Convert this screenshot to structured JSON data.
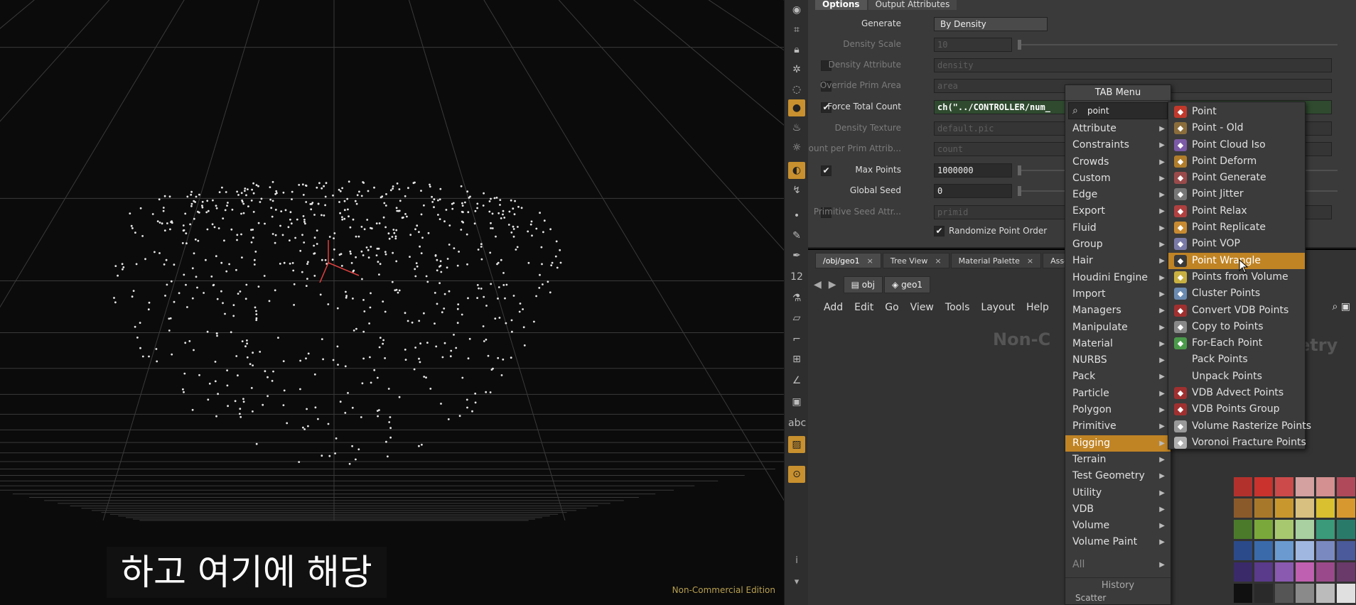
{
  "viewport": {
    "subtitle": "하고 여기에 해당",
    "edition_label": "Non-Commercial Edition"
  },
  "toolstrip": {
    "info_icon_label": "i",
    "abc_label": "abc",
    "num_label": "12"
  },
  "params": {
    "tabs": [
      "Options",
      "Output Attributes"
    ],
    "rows": [
      {
        "label": "Generate",
        "value": "By Density",
        "type": "select"
      },
      {
        "label": "Density Scale",
        "value": "10",
        "type": "field-dim",
        "dim": true
      },
      {
        "label": "Density Attribute",
        "value": "density",
        "type": "field-wide-dim",
        "dim": true,
        "check": ""
      },
      {
        "label": "Override Prim Area",
        "value": "area",
        "type": "field-wide-dim",
        "dim": true,
        "check": ""
      },
      {
        "label": "Force Total Count",
        "value": "ch(\"../CONTROLLER/num_",
        "type": "expr",
        "check": "✔"
      },
      {
        "label": "Density Texture",
        "value": "default.pic",
        "type": "field-wide-dim",
        "dim": true
      },
      {
        "label": "Count per Prim Attrib...",
        "value": "count",
        "type": "field-wide-dim",
        "dim": true
      },
      {
        "label": "Max Points",
        "value": "1000000",
        "type": "field",
        "check": "✔"
      },
      {
        "label": "Global Seed",
        "value": "0",
        "type": "field"
      },
      {
        "label": "Primitive Seed Attr...",
        "value": "primid",
        "type": "field-wide-dim",
        "dim": true,
        "check": ""
      }
    ],
    "randomize_label": "Randomize Point Order"
  },
  "network": {
    "tabs": [
      "/obj/geo1",
      "Tree View",
      "Material Palette",
      "Asset Bro"
    ],
    "path": [
      "obj",
      "geo1"
    ],
    "menu": [
      "Add",
      "Edit",
      "Go",
      "View",
      "Tools",
      "Layout",
      "Help"
    ],
    "bg_text_left": "Non-C",
    "bg_text_right": "etry"
  },
  "tab_menu": {
    "title": "TAB Menu",
    "search_value": "point",
    "categories": [
      "Attribute",
      "Constraints",
      "Crowds",
      "Custom",
      "Edge",
      "Export",
      "Fluid",
      "Group",
      "Hair",
      "Houdini Engine",
      "Import",
      "Managers",
      "Manipulate",
      "Material",
      "NURBS",
      "Pack",
      "Particle",
      "Polygon",
      "Primitive",
      "Rigging",
      "Terrain",
      "Test Geometry",
      "Utility",
      "VDB",
      "Volume",
      "Volume Paint"
    ],
    "highlighted": "Rigging",
    "all_label": "All",
    "history_label": "History",
    "history_first": "Scatter"
  },
  "submenu": {
    "items": [
      {
        "label": "Point",
        "icon": "point-icon",
        "color": "#c0392b"
      },
      {
        "label": "Point - Old",
        "icon": "point-old-icon",
        "color": "#8a6d3b"
      },
      {
        "label": "Point Cloud Iso",
        "icon": "point-cloud-iso-icon",
        "color": "#7b5aa6"
      },
      {
        "label": "Point Deform",
        "icon": "point-deform-icon",
        "color": "#b07d2b"
      },
      {
        "label": "Point Generate",
        "icon": "point-generate-icon",
        "color": "#9a4a4a"
      },
      {
        "label": "Point Jitter",
        "icon": "point-jitter-icon",
        "color": "#777777"
      },
      {
        "label": "Point Relax",
        "icon": "point-relax-icon",
        "color": "#b04040"
      },
      {
        "label": "Point Replicate",
        "icon": "point-replicate-icon",
        "color": "#c88a30"
      },
      {
        "label": "Point VOP",
        "icon": "point-vop-icon",
        "color": "#7a7aa8"
      },
      {
        "label": "Point Wrangle",
        "icon": "point-wrangle-icon",
        "color": "#3a3a3a"
      },
      {
        "label": "Points from Volume",
        "icon": "points-from-volume-icon",
        "color": "#c8b040"
      },
      {
        "label": "Cluster Points",
        "icon": "cluster-points-icon",
        "color": "#6a8ab0"
      },
      {
        "label": "Convert VDB Points",
        "icon": "convert-vdb-points-icon",
        "color": "#a03030"
      },
      {
        "label": "Copy to Points",
        "icon": "copy-to-points-icon",
        "color": "#888888"
      },
      {
        "label": "For-Each Point",
        "icon": "for-each-point-icon",
        "color": "#4a9a4a"
      },
      {
        "label": "Pack Points",
        "icon": "",
        "color": ""
      },
      {
        "label": "Unpack Points",
        "icon": "",
        "color": ""
      },
      {
        "label": "VDB Advect Points",
        "icon": "vdb-advect-points-icon",
        "color": "#a03030"
      },
      {
        "label": "VDB Points Group",
        "icon": "vdb-points-group-icon",
        "color": "#a03030"
      },
      {
        "label": "Volume Rasterize Points",
        "icon": "volume-rasterize-points-icon",
        "color": "#999999"
      },
      {
        "label": "Voronoi Fracture Points",
        "icon": "voronoi-fracture-points-icon",
        "color": "#b0b0b0"
      }
    ],
    "highlighted": "Point Wrangle"
  },
  "palette": {
    "colors": [
      "#b3312c",
      "#c9322d",
      "#cc4a4a",
      "#d4a0a0",
      "#d49090",
      "#b04a5a",
      "#8a5a2a",
      "#a8782a",
      "#c8982e",
      "#d8c080",
      "#d8c030",
      "#d89830",
      "#4a7a2a",
      "#7aa83a",
      "#a8c870",
      "#a8d0a0",
      "#3a9a7a",
      "#2a7a6a",
      "#2a4a8a",
      "#3a6aaa",
      "#6a9ad0",
      "#a0b8e0",
      "#7a8ac0",
      "#4a5a9a",
      "#3a2a6a",
      "#5a3a8a",
      "#8a5ab0",
      "#c060b0",
      "#9a4a8a",
      "#6a3a6a",
      "#101010",
      "#2a2a2a",
      "#555555",
      "#8a8a8a",
      "#bbbbbb",
      "#e0e0e0"
    ]
  }
}
